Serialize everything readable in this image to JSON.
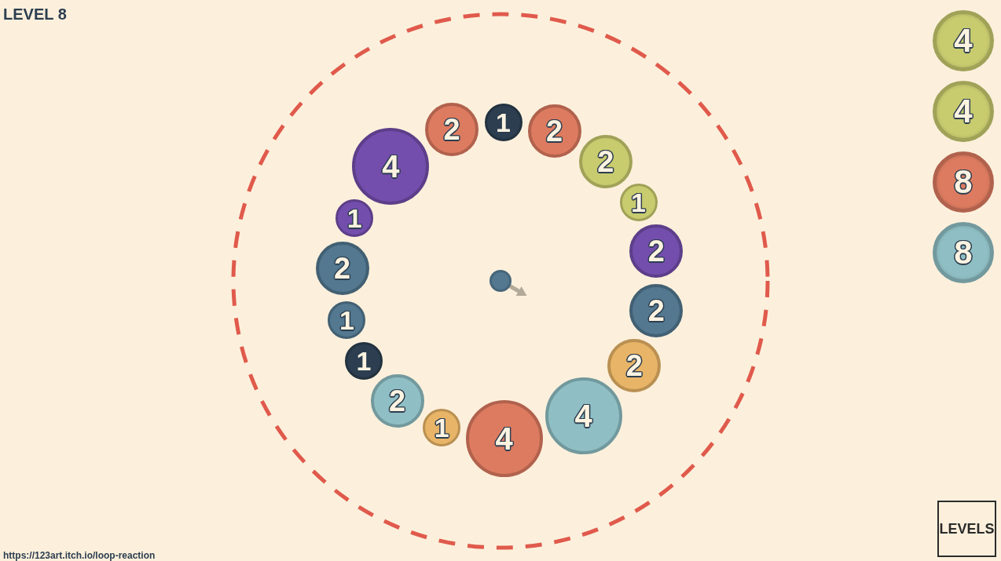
{
  "title": "LEVEL 8",
  "ring": {
    "right_side": [
      {
        "value": "1",
        "color": "#2c3e50",
        "kind": "small"
      },
      {
        "value": "2",
        "color": "#dd7b60",
        "kind": "medium"
      },
      {
        "value": "2",
        "color": "#c8cb6e",
        "kind": "medium"
      },
      {
        "value": "1",
        "color": "#c8cb6e",
        "kind": "small"
      },
      {
        "value": "2",
        "color": "#744ead",
        "kind": "medium"
      },
      {
        "value": "2",
        "color": "#537890",
        "kind": "medium"
      },
      {
        "value": "2",
        "color": "#e8b467",
        "kind": "medium"
      },
      {
        "value": "4",
        "color": "#8fbfc4",
        "kind": "large"
      },
      {
        "value": "4",
        "color": "#dd7b60",
        "kind": "large"
      }
    ],
    "left_side": [
      {
        "value": "2",
        "color": "#dd7b60",
        "kind": "medium"
      },
      {
        "value": "4",
        "color": "#744ead",
        "kind": "large"
      },
      {
        "value": "1",
        "color": "#744ead",
        "kind": "small"
      },
      {
        "value": "2",
        "color": "#537890",
        "kind": "medium"
      },
      {
        "value": "1",
        "color": "#537890",
        "kind": "small"
      },
      {
        "value": "1",
        "color": "#2c3e50",
        "kind": "small"
      },
      {
        "value": "2",
        "color": "#8fbfc4",
        "kind": "medium"
      },
      {
        "value": "1",
        "color": "#e8b467",
        "kind": "small"
      }
    ]
  },
  "shooter": {
    "color": "#537890"
  },
  "queue": [
    {
      "value": "4",
      "color": "#c8cb6e"
    },
    {
      "value": "4",
      "color": "#c8cb6e"
    },
    {
      "value": "8",
      "color": "#dd7b60"
    },
    {
      "value": "8",
      "color": "#8fbfc4"
    }
  ],
  "levels_button": "LEVELS",
  "footer_url": "https://123art.itch.io/loop-reaction"
}
